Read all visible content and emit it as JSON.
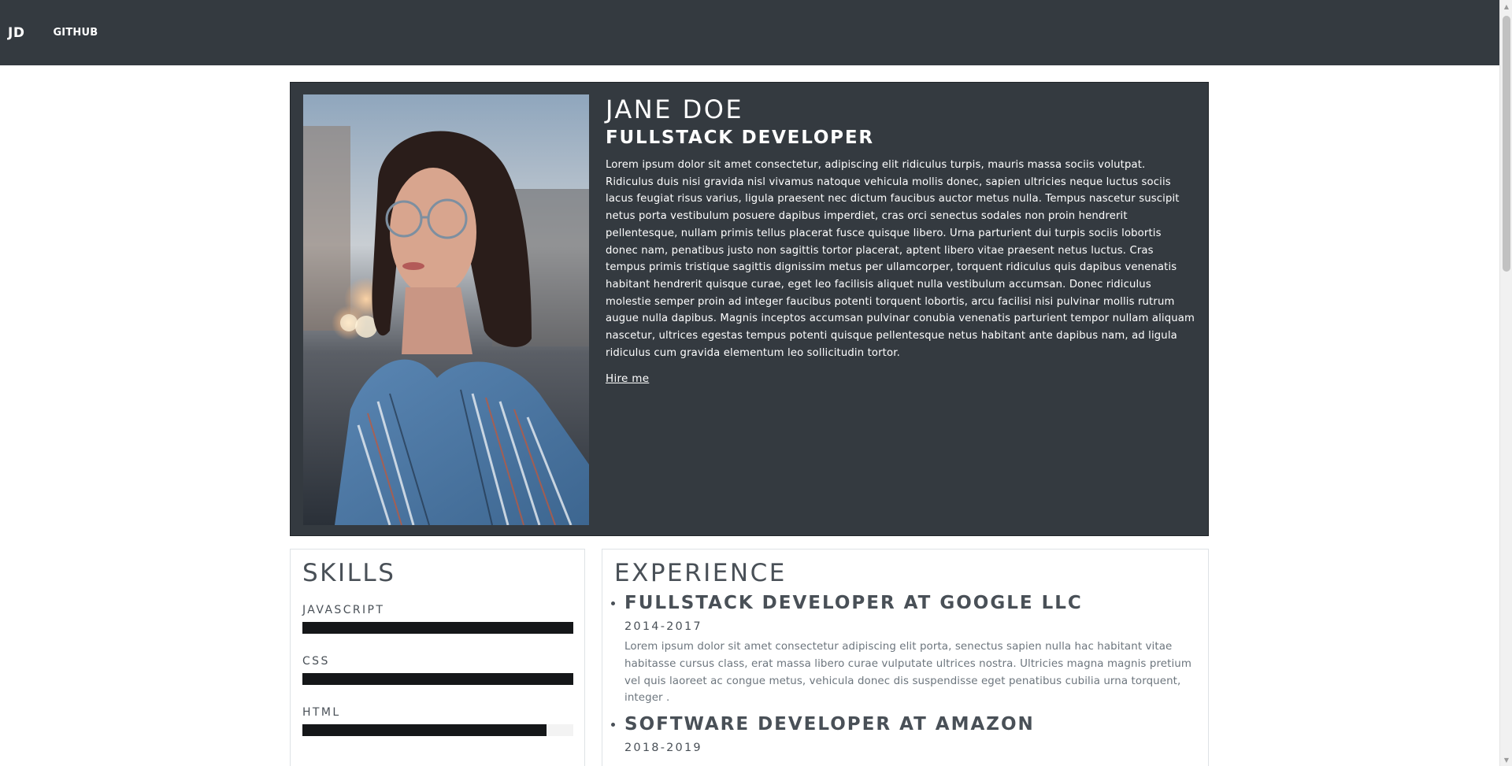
{
  "nav": {
    "brand": "JD",
    "links": [
      {
        "label": "GITHUB"
      }
    ]
  },
  "hero": {
    "photo_alt": "Portrait of a woman with glasses in a striped shirt",
    "name": "JANE DOE",
    "title": "FULLSTACK DEVELOPER",
    "bio": "Lorem ipsum dolor sit amet consectetur, adipiscing elit ridiculus turpis, mauris massa sociis volutpat. Ridiculus duis nisi gravida nisl vivamus natoque vehicula mollis donec, sapien ultricies neque luctus sociis lacus feugiat risus varius, ligula praesent nec dictum faucibus auctor metus nulla. Tempus nascetur suscipit netus porta vestibulum posuere dapibus imperdiet, cras orci senectus sodales non proin hendrerit pellentesque, nullam primis tellus placerat fusce quisque libero. Urna parturient dui turpis sociis lobortis donec nam, penatibus justo non sagittis tortor placerat, aptent libero vitae praesent netus luctus. Cras tempus primis tristique sagittis dignissim metus per ullamcorper, torquent ridiculus quis dapibus venenatis habitant hendrerit quisque curae, eget leo facilisis aliquet nulla vestibulum accumsan. Donec ridiculus molestie semper proin ad integer faucibus potenti torquent lobortis, arcu facilisi nisi pulvinar mollis rutrum augue nulla dapibus. Magnis inceptos accumsan pulvinar conubia venenatis parturient tempor nullam aliquam nascetur, ultrices egestas tempus potenti quisque pellentesque netus habitant ante dapibus nam, ad ligula ridiculus cum gravida elementum leo sollicitudin tortor.",
    "cta_label": "Hire me"
  },
  "skills": {
    "heading": "SKILLS",
    "items": [
      {
        "label": "JAVASCRIPT",
        "level": 1.0
      },
      {
        "label": "CSS",
        "level": 1.0
      },
      {
        "label": "HTML",
        "level": 0.9
      }
    ]
  },
  "experience": {
    "heading": "EXPERIENCE",
    "items": [
      {
        "title": "FULLSTACK DEVELOPER AT GOOGLE LLC",
        "dates": "2014-2017",
        "description": "Lorem ipsum dolor sit amet consectetur adipiscing elit porta, senectus sapien nulla hac habitant vitae habitasse cursus class, erat massa libero curae vulputate ultrices nostra. Ultricies magna magnis pretium vel quis laoreet ac congue metus, vehicula donec dis suspendisse eget penatibus cubilia urna torquent, integer ."
      },
      {
        "title": "SOFTWARE DEVELOPER AT AMAZON",
        "dates": "2018-2019",
        "description": ""
      }
    ]
  },
  "colors": {
    "nav_bg": "#343a40",
    "hero_bg": "#343a40",
    "skill_bar": "#151719",
    "heading_text": "#495057"
  }
}
